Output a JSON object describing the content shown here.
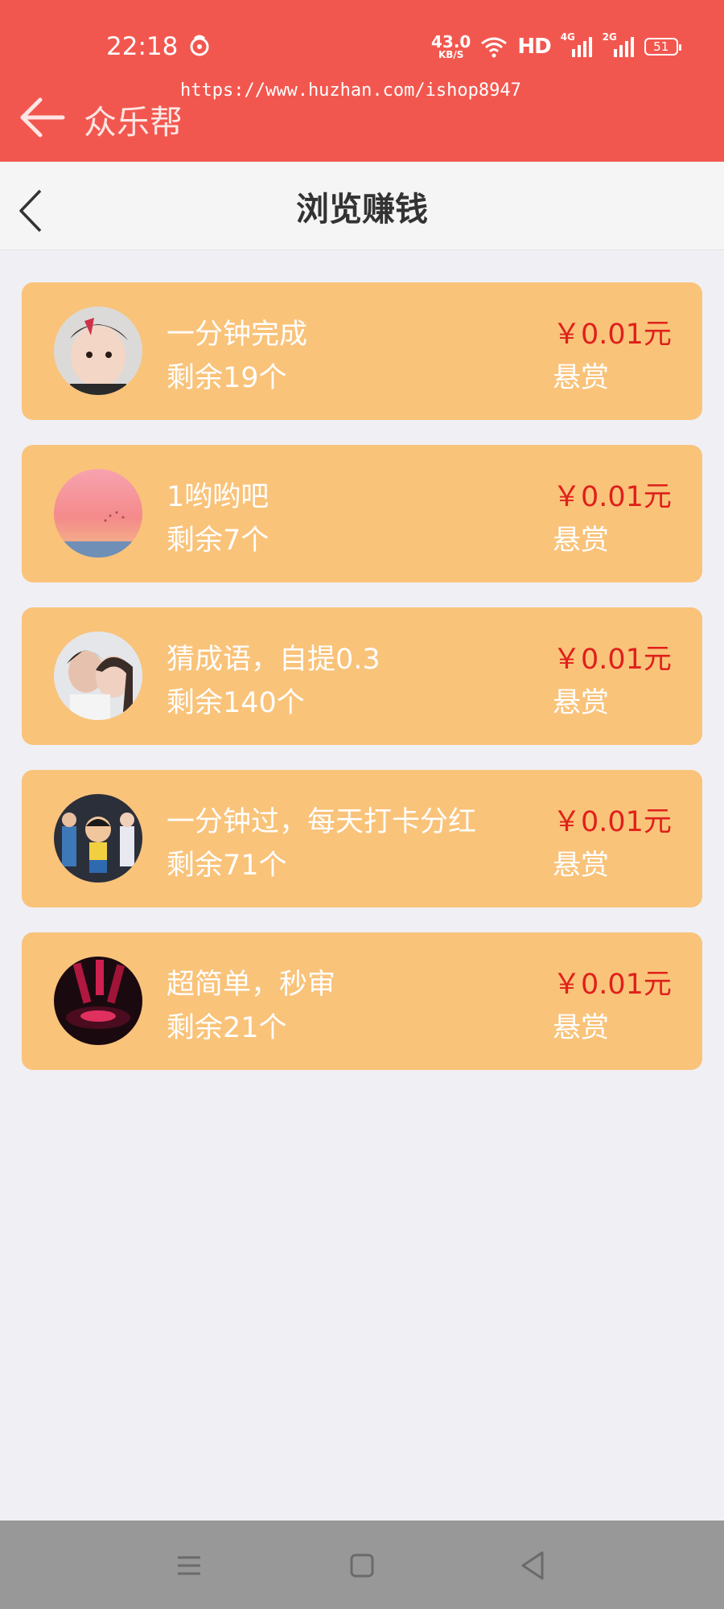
{
  "status_bar": {
    "time": "22:18",
    "net_speed": "43.0",
    "net_unit": "KB/S",
    "hd": "HD",
    "signal1_tag": "4G",
    "signal2_tag": "2G",
    "battery": "51"
  },
  "watermark": "https://www.huzhan.com/ishop8947",
  "app_header": {
    "title": "众乐帮"
  },
  "nav": {
    "title": "浏览赚钱"
  },
  "tasks": [
    {
      "title": "一分钟完成",
      "remaining": "剩余19个",
      "reward": "￥0.01元",
      "reward_label": "悬赏"
    },
    {
      "title": "1哟哟吧",
      "remaining": "剩余7个",
      "reward": "￥0.01元",
      "reward_label": "悬赏"
    },
    {
      "title": "猜成语，自提0.3",
      "remaining": "剩余140个",
      "reward": "￥0.01元",
      "reward_label": "悬赏"
    },
    {
      "title": "一分钟过，每天打卡分红",
      "remaining": "剩余71个",
      "reward": "￥0.01元",
      "reward_label": "悬赏"
    },
    {
      "title": "超简单，秒审",
      "remaining": "剩余21个",
      "reward": "￥0.01元",
      "reward_label": "悬赏"
    }
  ],
  "colors": {
    "header_red": "#f2574f",
    "card_orange": "#f9c37a",
    "reward_red": "#e0201b",
    "page_bg": "#f0eff4"
  },
  "icons": {
    "back": "arrow-left-icon",
    "nav_back": "chevron-left-icon",
    "system": [
      "menu-icon",
      "home-square-icon",
      "back-triangle-icon"
    ]
  }
}
